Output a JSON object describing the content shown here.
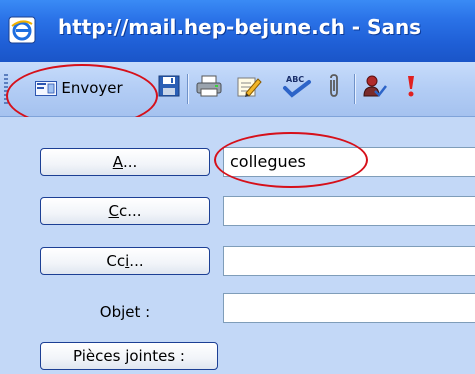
{
  "window": {
    "title": "http://mail.hep-bejune.ch - Sans"
  },
  "toolbar": {
    "send_label": "Envoyer",
    "icons": [
      "send-envelope-icon",
      "save-icon",
      "print-icon",
      "edit-note-icon",
      "spellcheck-icon",
      "attach-paperclip-icon",
      "check-names-icon",
      "importance-high-icon"
    ]
  },
  "form": {
    "to_button": {
      "pre": "",
      "accel": "A",
      "post": "..."
    },
    "cc_button": {
      "pre": "",
      "accel": "C",
      "post": "c..."
    },
    "bcc_button": {
      "pre": "Cc",
      "accel": "i",
      "post": "..."
    },
    "subject_label": "Objet :",
    "attachments_button": "Pièces jointes :",
    "to_value": "collegues",
    "cc_value": "",
    "bcc_value": "",
    "subject_value": ""
  },
  "colors": {
    "titlebar": "#2b73e8",
    "toolbar": "#b3cdf5",
    "form_bg": "#c3d8f7",
    "highlight": "#d6101a"
  }
}
